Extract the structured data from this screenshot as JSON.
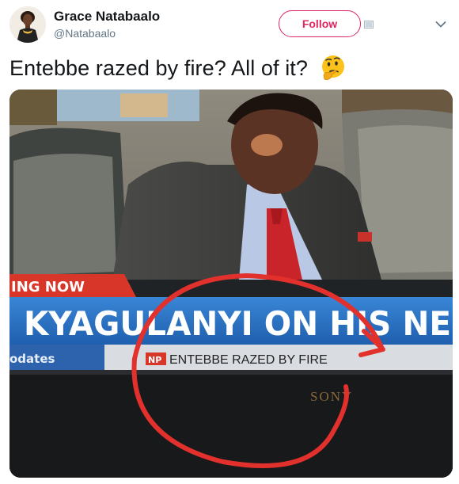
{
  "user": {
    "name": "Grace Natabaalo",
    "handle": "@Natabaalo"
  },
  "actions": {
    "follow_label": "Follow"
  },
  "icons": {
    "avatar": "avatar-photo",
    "blocked": "blocked-icon",
    "more": "chevron-down-icon",
    "emoji": "thinking-face-emoji"
  },
  "tweet": {
    "text": "Entebbe razed by fire? All of it?"
  },
  "photo": {
    "breaking_label": "ING NOW",
    "headline": "KYAGULANYI ON HIS NE",
    "updates_label": "odates",
    "ticker_logo": "NP",
    "ticker_text": "ENTEBBE RAZED BY FIRE",
    "tv_brand": "SONY"
  },
  "colors": {
    "follow_accent": "#e0245e",
    "circle_annotation": "#e2312c",
    "breaking_red": "#d9362a",
    "headline_blue": "#2a6fc1"
  }
}
